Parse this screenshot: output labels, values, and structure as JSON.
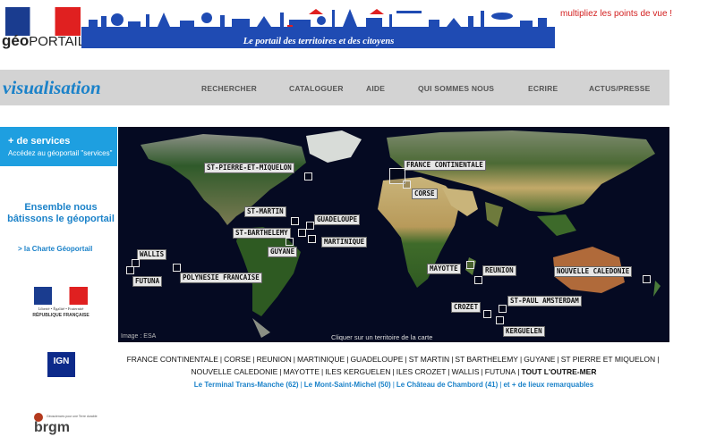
{
  "header": {
    "logo_main": "géo",
    "logo_rest": "PORTAIL",
    "banner_text": "Le portail des territoires et des citoyens",
    "tagline": "multipliez les points de vue !"
  },
  "nav": {
    "section_title": "visualisation",
    "items": [
      "RECHERCHER",
      "CATALOGUER",
      "AIDE",
      "QUI SOMMES NOUS",
      "ECRIRE",
      "ACTUS/PRESSE"
    ]
  },
  "sidebar": {
    "services_title": "+ de services",
    "services_subtitle": "Accédez au géoportail \"services\"",
    "ensemble": "Ensemble nous bâtissons le géoportail",
    "charte_link": "> la Charte Géoportail",
    "rf_motto": "Liberté • Égalité • Fraternité",
    "rf_name": "RÉPUBLIQUE FRANÇAISE",
    "ign_label": "IGN",
    "brgm_label": "brgm",
    "brgm_sub": "Géosciences pour une Terre durable"
  },
  "map": {
    "credit": "Image : ESA",
    "hint": "Cliquer sur un territoire de la carte",
    "ocean_color": "#050a22",
    "labels": [
      {
        "id": "st-pierre",
        "text": "ST-PIERRE-ET-MIQUELON"
      },
      {
        "id": "france",
        "text": "FRANCE CONTINENTALE"
      },
      {
        "id": "corse",
        "text": "CORSE"
      },
      {
        "id": "st-martin",
        "text": "ST-MARTIN"
      },
      {
        "id": "guadeloupe",
        "text": "GUADELOUPE"
      },
      {
        "id": "st-barthelemy",
        "text": "ST-BARTHELEMY"
      },
      {
        "id": "martinique",
        "text": "MARTINIQUE"
      },
      {
        "id": "guyane",
        "text": "GUYANE"
      },
      {
        "id": "wallis",
        "text": "WALLIS"
      },
      {
        "id": "futuna",
        "text": "FUTUNA"
      },
      {
        "id": "polynesie",
        "text": "POLYNESIE FRANCAISE"
      },
      {
        "id": "mayotte",
        "text": "MAYOTTE"
      },
      {
        "id": "reunion",
        "text": "REUNION"
      },
      {
        "id": "nouvelle-caledonie",
        "text": "NOUVELLE CALEDONIE"
      },
      {
        "id": "crozet",
        "text": "CROZET"
      },
      {
        "id": "st-paul",
        "text": "ST-PAUL AMSTERDAM"
      },
      {
        "id": "kerguelen",
        "text": "KERGUELEN"
      }
    ]
  },
  "territories": {
    "row1": [
      "FRANCE CONTINENTALE",
      "CORSE",
      "REUNION",
      "MARTINIQUE",
      "GUADELOUPE",
      "ST MARTIN",
      "ST BARTHELEMY",
      "GUYANE",
      "ST PIERRE ET MIQUELON"
    ],
    "row2": [
      "NOUVELLE CALEDONIE",
      "MAYOTTE",
      "ILES KERGUELEN",
      "ILES CROZET",
      "WALLIS",
      "FUTUNA"
    ],
    "all": "TOUT L'OUTRE-MER",
    "places": [
      "Le Terminal Trans-Manche (62)",
      "Le Mont-Saint-Michel (50)",
      "Le Château de Chambord (41)",
      "et + de lieux remarquables"
    ]
  }
}
